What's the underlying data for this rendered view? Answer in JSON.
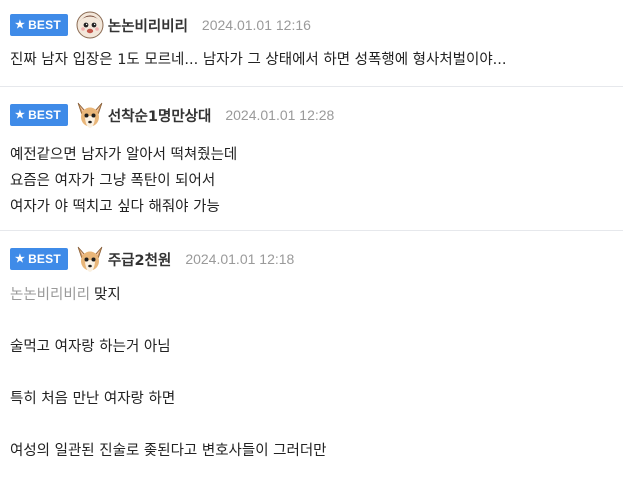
{
  "comments": [
    {
      "badge": "BEST",
      "nickname": "논논비리비리",
      "time": "2024.01.01 12:16",
      "lines": [
        "진짜 남자 입장은 1도 모르네... 남자가 그 상태에서 하면 성폭행에 형사처벌이야..."
      ]
    },
    {
      "badge": "BEST",
      "nickname": "선착순1명만상대",
      "time": "2024.01.01 12:28",
      "lines": [
        "예전같으면 남자가 알아서 떡쳐줬는데",
        "요즘은 여자가 그냥 폭탄이 되어서",
        "여자가 야 떡치고 싶다 해줘야 가능"
      ]
    },
    {
      "badge": "BEST",
      "nickname": "주급2천원",
      "time": "2024.01.01 12:18",
      "mention": "논논비리비리",
      "lines": [
        "맞지",
        "",
        "술먹고 여자랑 하는거 아님",
        "",
        "특히 처음 만난 여자랑 하면",
        "",
        "여성의 일관된 진술로 좆된다고 변호사들이 그러더만"
      ]
    }
  ]
}
